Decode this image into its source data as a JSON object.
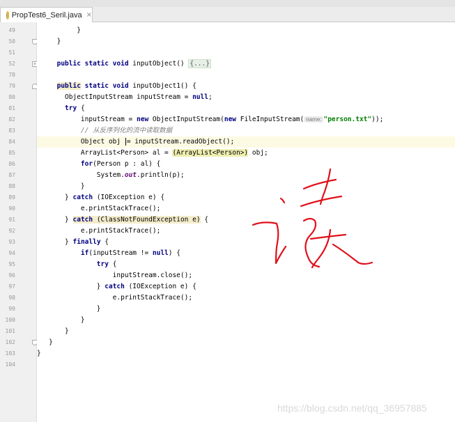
{
  "tab": {
    "title": "PropTest6_Seril.java",
    "close": "×",
    "icon": "java-class-icon"
  },
  "watermark": "https://blog.csdn.net/qq_36957885",
  "handwriting": "读",
  "lines": [
    {
      "n": "49"
    },
    {
      "n": "50"
    },
    {
      "n": "51"
    },
    {
      "n": "52"
    },
    {
      "n": "78"
    },
    {
      "n": "79"
    },
    {
      "n": "80"
    },
    {
      "n": "81"
    },
    {
      "n": "82"
    },
    {
      "n": "83"
    },
    {
      "n": "84"
    },
    {
      "n": "85"
    },
    {
      "n": "86"
    },
    {
      "n": "87"
    },
    {
      "n": "88"
    },
    {
      "n": "89"
    },
    {
      "n": "90"
    },
    {
      "n": "91"
    },
    {
      "n": "92"
    },
    {
      "n": "93"
    },
    {
      "n": "94"
    },
    {
      "n": "95"
    },
    {
      "n": "96"
    },
    {
      "n": "97"
    },
    {
      "n": "98"
    },
    {
      "n": "99"
    },
    {
      "n": "100"
    },
    {
      "n": "101"
    },
    {
      "n": "102"
    },
    {
      "n": "103"
    },
    {
      "n": "104"
    }
  ],
  "code": {
    "l49": "}",
    "l50": "}",
    "l52_kw": "public static void",
    "l52_name": " inputObject() ",
    "l52_fold": "{...}",
    "l79_kw1": "public",
    "l79_kw2": " static void",
    "l79_rest": " inputObject1() {",
    "l80": "ObjectInputStream inputStream = ",
    "l80_kw": "null",
    "l80_end": ";",
    "l81_kw": "try",
    "l81_rest": " {",
    "l82_a": "inputStream = ",
    "l82_new1": "new",
    "l82_b": " ObjectInputStream(",
    "l82_new2": "new",
    "l82_c": " FileInputStream(",
    "l82_hint": "name:",
    "l82_str": "\"person.txt\"",
    "l82_end": "));",
    "l83": "// 从反序列化的流中读取数据",
    "l84_a": "Object obj ",
    "l84_b": "= inputStream.readObject();",
    "l85_a": "ArrayList<Person> al = ",
    "l85_cast": "(ArrayList<Person>)",
    "l85_b": " obj;",
    "l86_kw": "for",
    "l86_rest": "(Person p : al) {",
    "l87_a": "System.",
    "l87_out": "out",
    "l87_b": ".println(p);",
    "l88": "}",
    "l89_a": "} ",
    "l89_kw": "catch",
    "l89_b": " (IOException e) {",
    "l90": "e.printStackTrace();",
    "l91_a": "} ",
    "l91_kw": "catch",
    "l91_b": " (ClassNotFoundException e)",
    "l91_c": " {",
    "l92": "e.printStackTrace();",
    "l93_a": "} ",
    "l93_kw": "finally",
    "l93_b": " {",
    "l94_kw": "if",
    "l94_a": "(inputStream != ",
    "l94_kw2": "null",
    "l94_b": ") {",
    "l95_kw": "try",
    "l95_rest": " {",
    "l96": "inputStream.close();",
    "l97_a": "} ",
    "l97_kw": "catch",
    "l97_b": " (IOException e) {",
    "l98": "e.printStackTrace();",
    "l99": "}",
    "l100": "}",
    "l101": "}",
    "l102": "}",
    "l103": "}"
  }
}
